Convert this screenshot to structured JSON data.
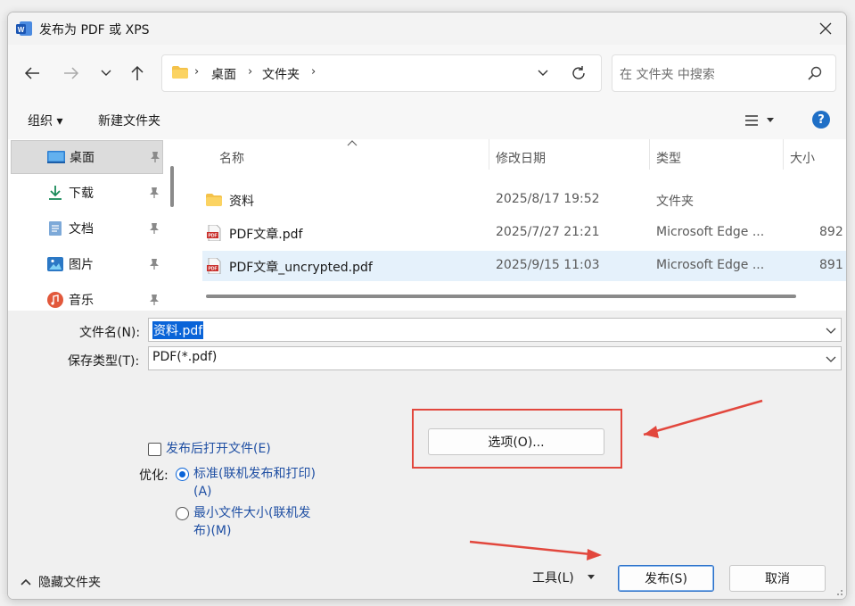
{
  "window": {
    "title": "发布为 PDF 或 XPS"
  },
  "nav": {
    "breadcrumb": [
      "桌面",
      "文件夹"
    ],
    "search_placeholder": "在 文件夹 中搜索"
  },
  "commands": {
    "organize": "组织 ▾",
    "new_folder": "新建文件夹",
    "help": "?"
  },
  "sidebar": {
    "items": [
      {
        "label": "桌面",
        "icon": "desktop-icon",
        "selected": true
      },
      {
        "label": "下载",
        "icon": "download-icon",
        "selected": false
      },
      {
        "label": "文档",
        "icon": "document-icon",
        "selected": false
      },
      {
        "label": "图片",
        "icon": "picture-icon",
        "selected": false
      },
      {
        "label": "音乐",
        "icon": "music-icon",
        "selected": false
      }
    ]
  },
  "filelist": {
    "columns": [
      "名称",
      "修改日期",
      "类型",
      "大小"
    ],
    "rows": [
      {
        "name": "资料",
        "date": "2025/8/17 19:52",
        "type": "文件夹",
        "size": "",
        "icon": "folder-icon"
      },
      {
        "name": "PDF文章.pdf",
        "date": "2025/7/27 21:21",
        "type": "Microsoft Edge ...",
        "size": "892",
        "icon": "pdf-icon"
      },
      {
        "name": "PDF文章_uncrypted.pdf",
        "date": "2025/9/15 11:03",
        "type": "Microsoft Edge ...",
        "size": "891",
        "icon": "pdf-icon"
      }
    ]
  },
  "form": {
    "filename_label": "文件名(N):",
    "filename_value": "资料.pdf",
    "filetype_label": "保存类型(T):",
    "filetype_value": "PDF(*.pdf)",
    "open_after_publish": "发布后打开文件(E)",
    "optimize_label": "优化:",
    "optimize_standard_line1": "标准(联机发布和打印)",
    "optimize_standard_line2": "(A)",
    "optimize_minimum_line1": "最小文件大小(联机发",
    "optimize_minimum_line2": "布)(M)",
    "options_button": "选项(O)..."
  },
  "footer": {
    "hide_folders": "隐藏文件夹",
    "tools": "工具(L)",
    "publish": "发布(S)",
    "cancel": "取消"
  },
  "colors": {
    "accent": "#0a64d8",
    "annotation_red": "#e2473d",
    "selected_row": "#e5f1fb"
  }
}
